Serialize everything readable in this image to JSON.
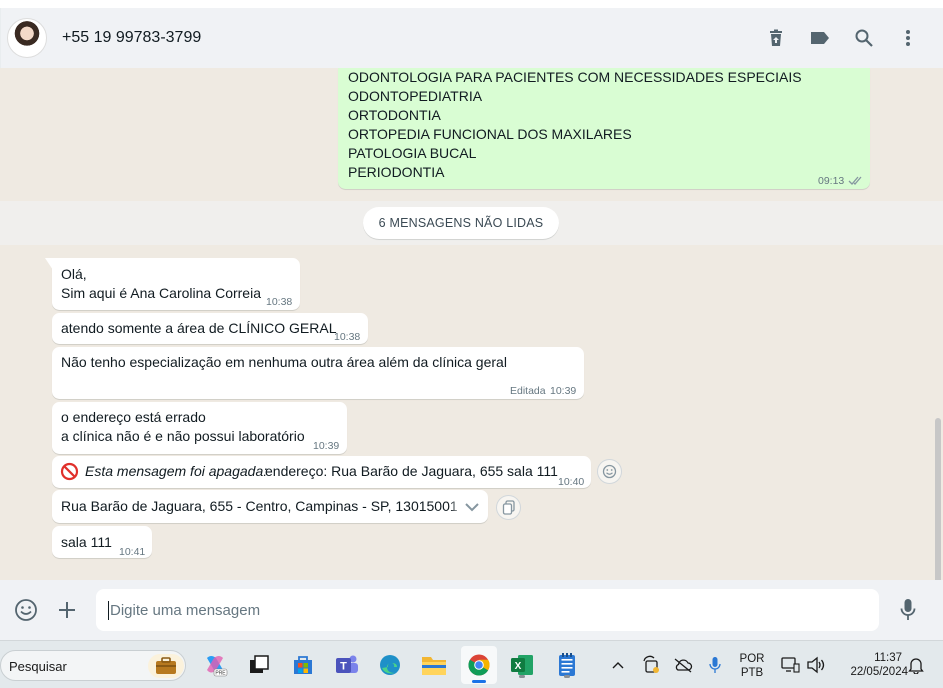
{
  "header": {
    "contact": "+55 19 99783-3799",
    "icons": [
      "archive-icon",
      "label-icon",
      "search-icon",
      "menu-icon"
    ]
  },
  "outgoing_block": {
    "lines": [
      "ODONTOLOGIA PARA PACIENTES COM NECESSIDADES ESPECIAIS",
      "ODONTOPEDIATRIA",
      "ORTODONTIA",
      "ORTOPEDIA FUNCIONAL DOS MAXILARES",
      "PATOLOGIA BUCAL",
      "PERIODONTIA"
    ],
    "time": "09:13"
  },
  "unread_label": "6 MENSAGENS NÃO LIDAS",
  "messages": [
    {
      "line1": "Olá,",
      "line2": "Sim aqui é Ana Carolina Correia",
      "time": "10:38"
    },
    {
      "text": "atendo somente a área de CLÍNICO GERAL",
      "time": "10:38"
    },
    {
      "text": "Não tenho especialização em nenhuma outra área além da clínica geral",
      "edited": "Editada",
      "time": "10:39"
    },
    {
      "line1": "o endereço está errado",
      "line2": "a clínica não é e não possui laboratório",
      "time": "10:39"
    },
    {
      "deleted_label": "Esta mensagem foi apagada:",
      "text": "endereço: Rua Barão de Jaguara, 655 sala 111",
      "time": "10:40"
    },
    {
      "text": "Rua Barão de Jaguara, 655 - Centro, Campinas - SP, 13015001"
    },
    {
      "text": "sala 111",
      "time": "10:41"
    }
  ],
  "composer": {
    "placeholder": "Digite uma mensagem"
  },
  "taskbar": {
    "search_label": "Pesquisar",
    "lang": "POR",
    "layout": "PTB",
    "time": "11:37",
    "date": "22/05/2024"
  },
  "colors": {
    "outgoing_bubble": "#d9fdd3",
    "incoming_bubble": "#ffffff",
    "chat_bg": "#efeae2",
    "header_bg": "#f0f2f5"
  }
}
